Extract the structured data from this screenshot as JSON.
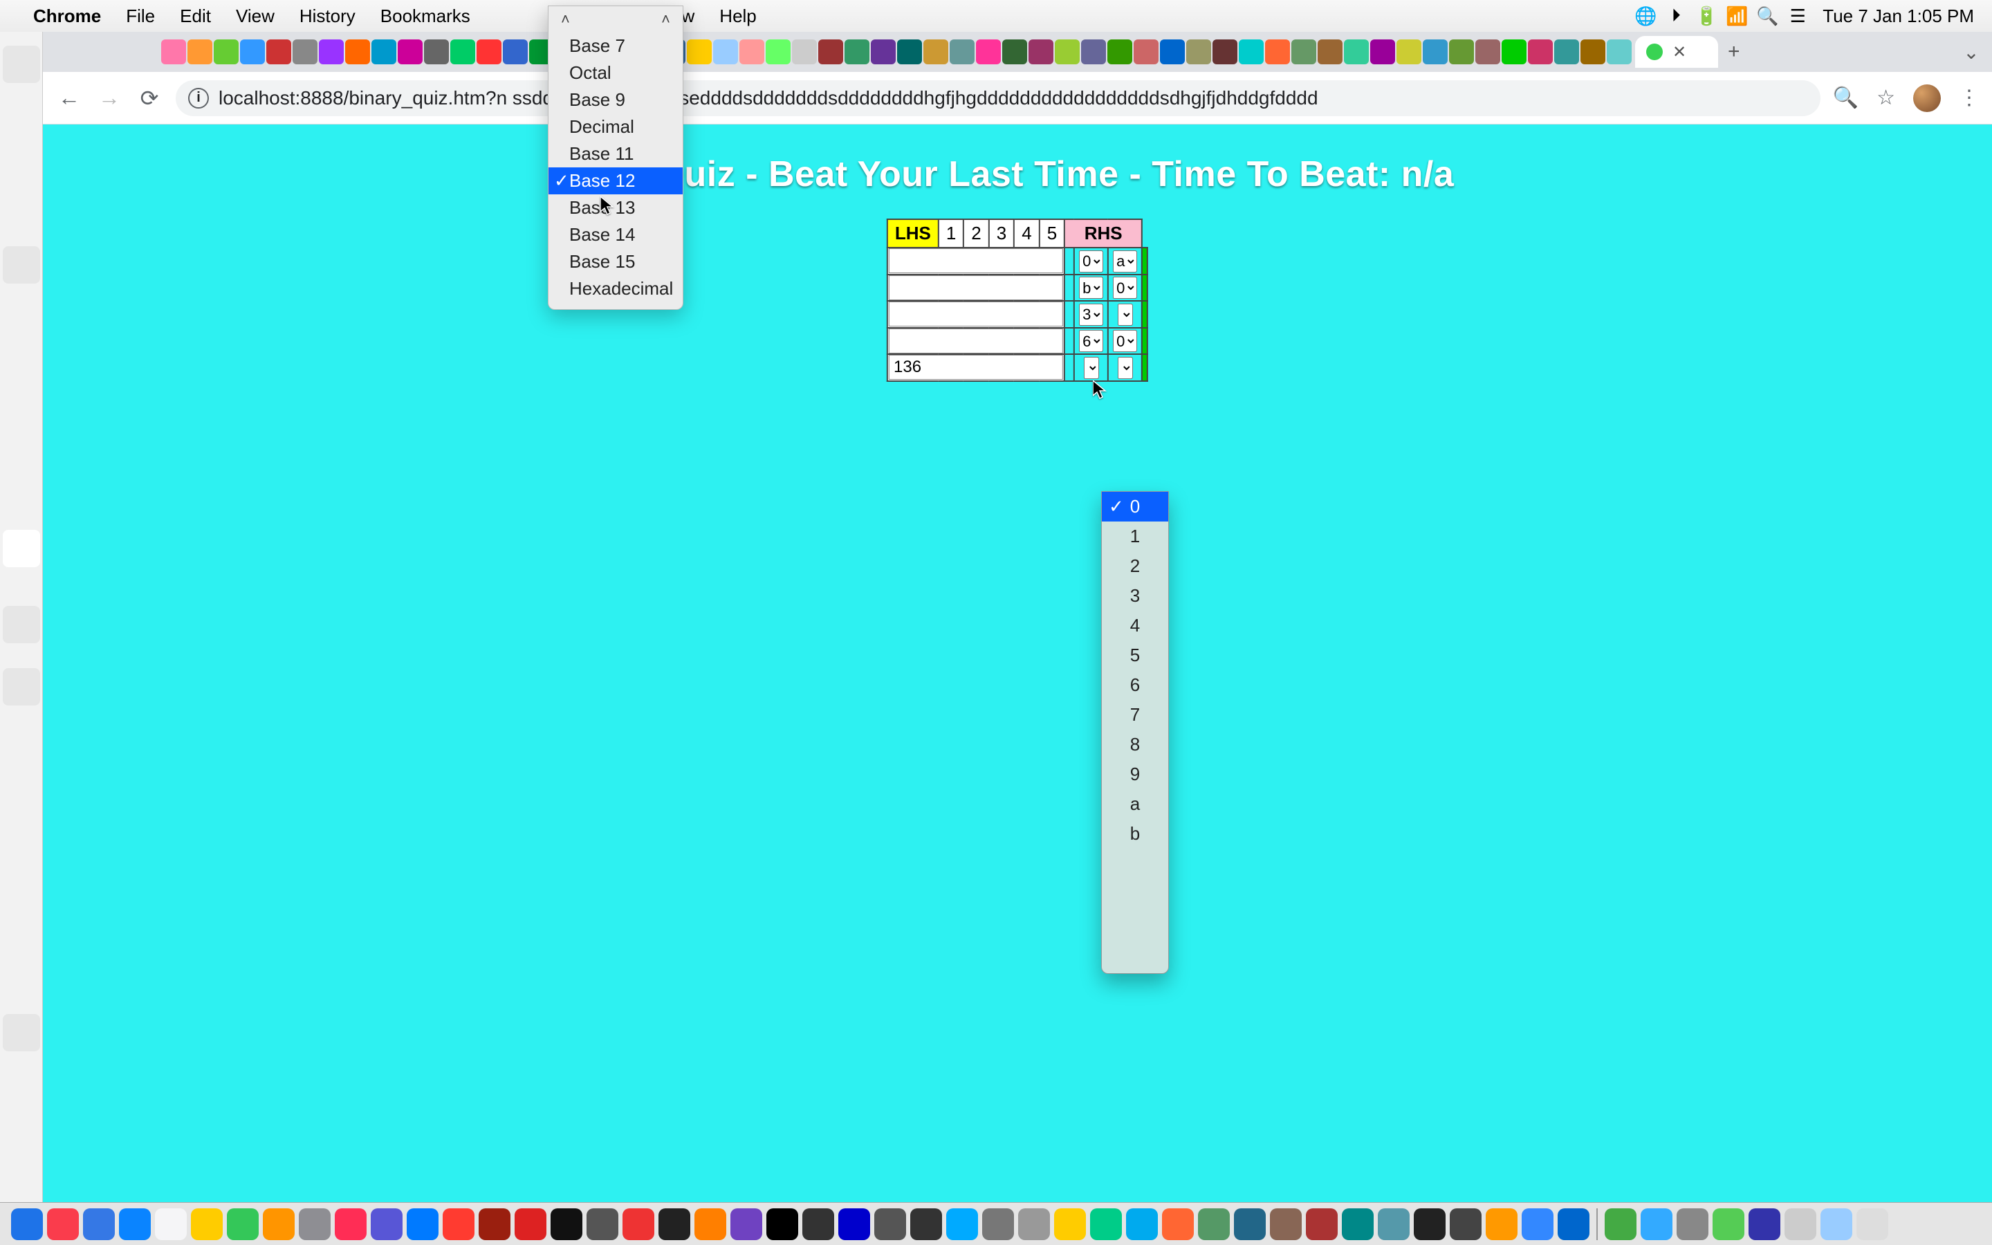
{
  "menubar": {
    "app": "Chrome",
    "items": [
      "File",
      "Edit",
      "View",
      "History",
      "Bookmarks",
      "Window",
      "Help"
    ],
    "clock": "Tue 7 Jan  1:05 PM"
  },
  "toolbar": {
    "url": "localhost:8888/binary_quiz.htm?n                ssdddsddxddsdeddseddddsdddddddsddddddddhgfjhgdddddddddddddddddsdhgjfjdhddgfdddd"
  },
  "base_menu": {
    "items": [
      "Base 7",
      "Octal",
      "Base 9",
      "Decimal",
      "Base 11",
      "Base 12",
      "Base 13",
      "Base 14",
      "Base 15",
      "Hexadecimal"
    ],
    "selected": "Base 12"
  },
  "page": {
    "title": "The                 Quiz - Beat Your Last Time - Time To Beat: n/a",
    "headers": {
      "lhs": "LHS",
      "nums": [
        "1",
        "2",
        "3",
        "4",
        "5"
      ],
      "rhs": "RHS"
    },
    "rows": [
      {
        "lhs": "",
        "d1": "0",
        "d2": "a"
      },
      {
        "lhs": "",
        "d1": "b",
        "d2": "0"
      },
      {
        "lhs": "",
        "d1": "3",
        "d2": ""
      },
      {
        "lhs": "",
        "d1": "6",
        "d2": "0"
      },
      {
        "lhs": "136",
        "d1": "",
        "d2": ""
      }
    ]
  },
  "opt_menu": {
    "items": [
      "0",
      "1",
      "2",
      "3",
      "4",
      "5",
      "6",
      "7",
      "8",
      "9",
      "a",
      "b"
    ],
    "selected": "0"
  },
  "dock_colors": [
    "#1e73e8",
    "#fa3c4c",
    "#3578e5",
    "#0a84ff",
    "#f5f5f7",
    "#ffcc00",
    "#34c759",
    "#ff9500",
    "#8e8e93",
    "#ff2d55",
    "#5856d6",
    "#007aff",
    "#ff3b30",
    "#9a1f0f",
    "#d22",
    "#111",
    "#555",
    "#e33",
    "#222",
    "#ff7f00",
    "#6f42c1",
    "#000",
    "#333",
    "#00c",
    "#555",
    "#333",
    "#0af",
    "#777",
    "#999",
    "#fc0",
    "#0c8",
    "#0ae",
    "#f63",
    "#596",
    "#268",
    "#865",
    "#a33",
    "#088",
    "#59a",
    "#222",
    "#444",
    "#f90",
    "#38f",
    "#06c",
    "#4a4",
    "#3af",
    "#888",
    "#5c5",
    "#33a",
    "#ccc",
    "#9cf",
    "#ddd"
  ]
}
